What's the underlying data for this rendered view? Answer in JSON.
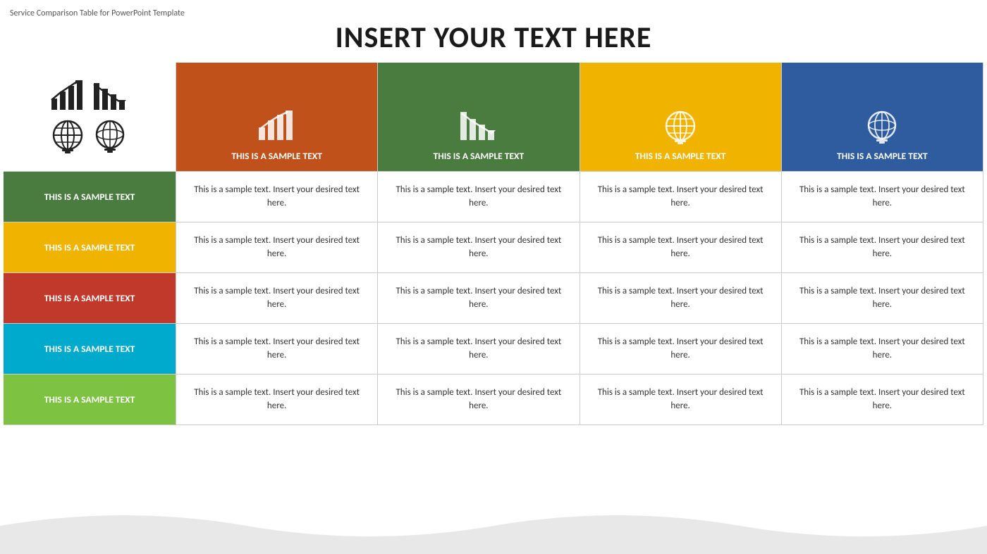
{
  "watermark": "Service Comparison Table for PowerPoint Template",
  "title": "INSERT YOUR TEXT HERE",
  "icons": {
    "topleft1": "bar-chart-up-icon",
    "topleft2": "bar-chart-down-icon",
    "topleft3": "globe-flat-icon",
    "topleft4": "globe-3d-icon"
  },
  "columns": [
    {
      "id": "col1",
      "colorClass": "col-header-orange",
      "bgColor": "#c0511a",
      "iconType": "bar-chart-up",
      "label": "THIS IS A SAMPLE TEXT"
    },
    {
      "id": "col2",
      "colorClass": "col-header-green",
      "bgColor": "#4a7c3f",
      "iconType": "bar-chart-down",
      "label": "THIS IS A SAMPLE TEXT"
    },
    {
      "id": "col3",
      "colorClass": "col-header-yellow",
      "bgColor": "#f0b400",
      "iconType": "globe-flat",
      "label": "THIS IS A SAMPLE TEXT"
    },
    {
      "id": "col4",
      "colorClass": "col-header-blue",
      "bgColor": "#2e5c9e",
      "iconType": "globe-3d",
      "label": "THIS IS A SAMPLE TEXT"
    }
  ],
  "rows": [
    {
      "id": "row1",
      "label": "THIS IS A SAMPLE TEXT",
      "bgColor": "#4a7c3f",
      "cells": [
        "This is a sample text. Insert your desired text here.",
        "This is a sample text. Insert your desired text here.",
        "This is a sample text. Insert your desired text here.",
        "This is a sample text. Insert your desired text here."
      ]
    },
    {
      "id": "row2",
      "label": "THIS IS A SAMPLE TEXT",
      "bgColor": "#f0b400",
      "cells": [
        "This is a sample text. Insert your desired text here.",
        "This is a sample text. Insert your desired text here.",
        "This is a sample text. Insert your desired text here.",
        "This is a sample text. Insert your desired text here."
      ]
    },
    {
      "id": "row3",
      "label": "THIS IS A SAMPLE TEXT",
      "bgColor": "#c0392b",
      "cells": [
        "This is a sample text. Insert your desired text here.",
        "This is a sample text. Insert your desired text here.",
        "This is a sample text. Insert your desired text here.",
        "This is a sample text. Insert your desired text here."
      ]
    },
    {
      "id": "row4",
      "label": "THIS IS A SAMPLE TEXT",
      "bgColor": "#00aacc",
      "cells": [
        "This is a sample text. Insert your desired text here.",
        "This is a sample text. Insert your desired text here.",
        "This is a sample text. Insert your desired text here.",
        "This is a sample text. Insert your desired text here."
      ]
    },
    {
      "id": "row5",
      "label": "THIS IS A SAMPLE TEXT",
      "bgColor": "#7dc241",
      "cells": [
        "This is a sample text. Insert your desired text here.",
        "This is a sample text. Insert your desired text here.",
        "This is a sample text. Insert your desired text here.",
        "This is a sample text. Insert your desired text here."
      ]
    }
  ]
}
